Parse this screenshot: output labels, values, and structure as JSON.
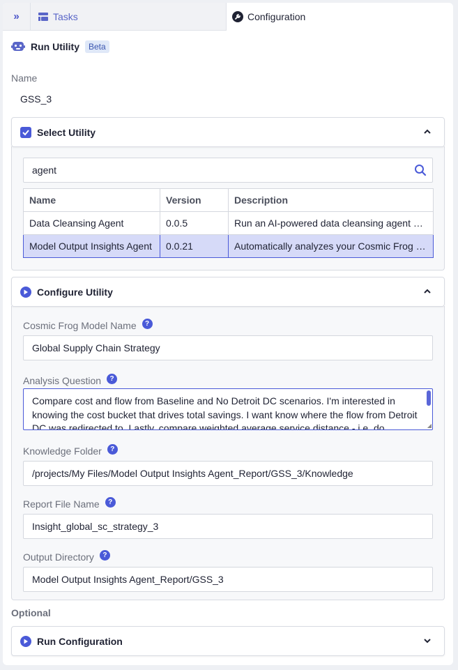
{
  "tabs": {
    "tasks_label": "Tasks",
    "configuration_label": "Configuration"
  },
  "header": {
    "title": "Run Utility",
    "badge": "Beta"
  },
  "name_field": {
    "label": "Name",
    "value": "GSS_3"
  },
  "select_utility": {
    "title": "Select Utility",
    "search_value": "agent",
    "columns": [
      "Name",
      "Version",
      "Description"
    ],
    "rows": [
      {
        "name": "Data Cleansing Agent",
        "version": "0.0.5",
        "description": "Run an AI-powered data cleansing agent w…"
      },
      {
        "name": "Model Output Insights Agent",
        "version": "0.0.21",
        "description": "Automatically analyzes your Cosmic Frog …"
      }
    ]
  },
  "configure_utility": {
    "title": "Configure Utility",
    "fields": {
      "model_name": {
        "label": "Cosmic Frog Model Name",
        "value": "Global Supply Chain Strategy"
      },
      "analysis_question": {
        "label": "Analysis Question",
        "value": "Compare cost and flow from Baseline and No Detroit DC scenarios. I'm interested in knowing the cost bucket that drives total savings. I want know where the flow from Detroit DC was redirected to. Lastly, compare weighted average service distance - i.e. do"
      },
      "knowledge_folder": {
        "label": "Knowledge Folder",
        "value": "/projects/My Files/Model Output Insights Agent_Report/GSS_3/Knowledge"
      },
      "report_file_name": {
        "label": "Report File Name",
        "value": "Insight_global_sc_strategy_3"
      },
      "output_directory": {
        "label": "Output Directory",
        "value": "Model Output Insights Agent_Report/GSS_3"
      }
    }
  },
  "optional_label": "Optional",
  "run_configuration": {
    "title": "Run Configuration"
  },
  "colors": {
    "accent": "#4a5ad8",
    "selected_row": "#d6daf8"
  }
}
